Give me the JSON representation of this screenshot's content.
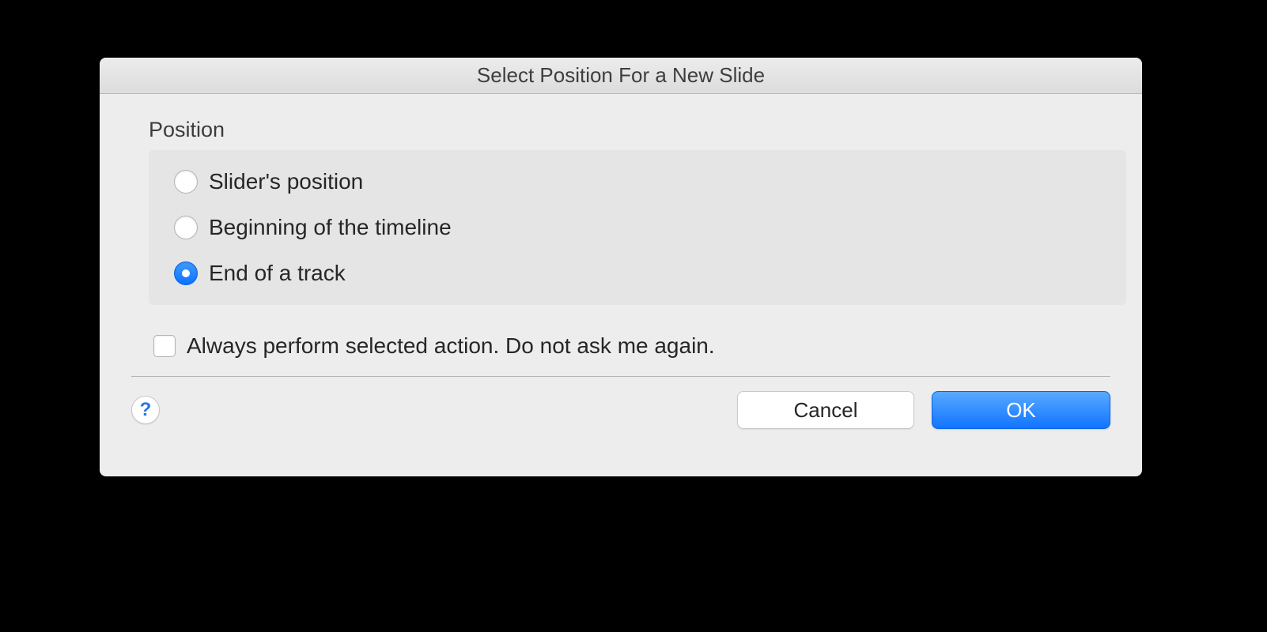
{
  "dialog": {
    "title": "Select Position For a New Slide",
    "section_label": "Position",
    "options": [
      {
        "label": "Slider's position",
        "selected": false
      },
      {
        "label": "Beginning of the timeline",
        "selected": false
      },
      {
        "label": "End of a track",
        "selected": true
      }
    ],
    "checkbox": {
      "label": "Always perform selected action. Do not ask me again.",
      "checked": false
    },
    "buttons": {
      "help": "?",
      "cancel": "Cancel",
      "ok": "OK"
    }
  }
}
